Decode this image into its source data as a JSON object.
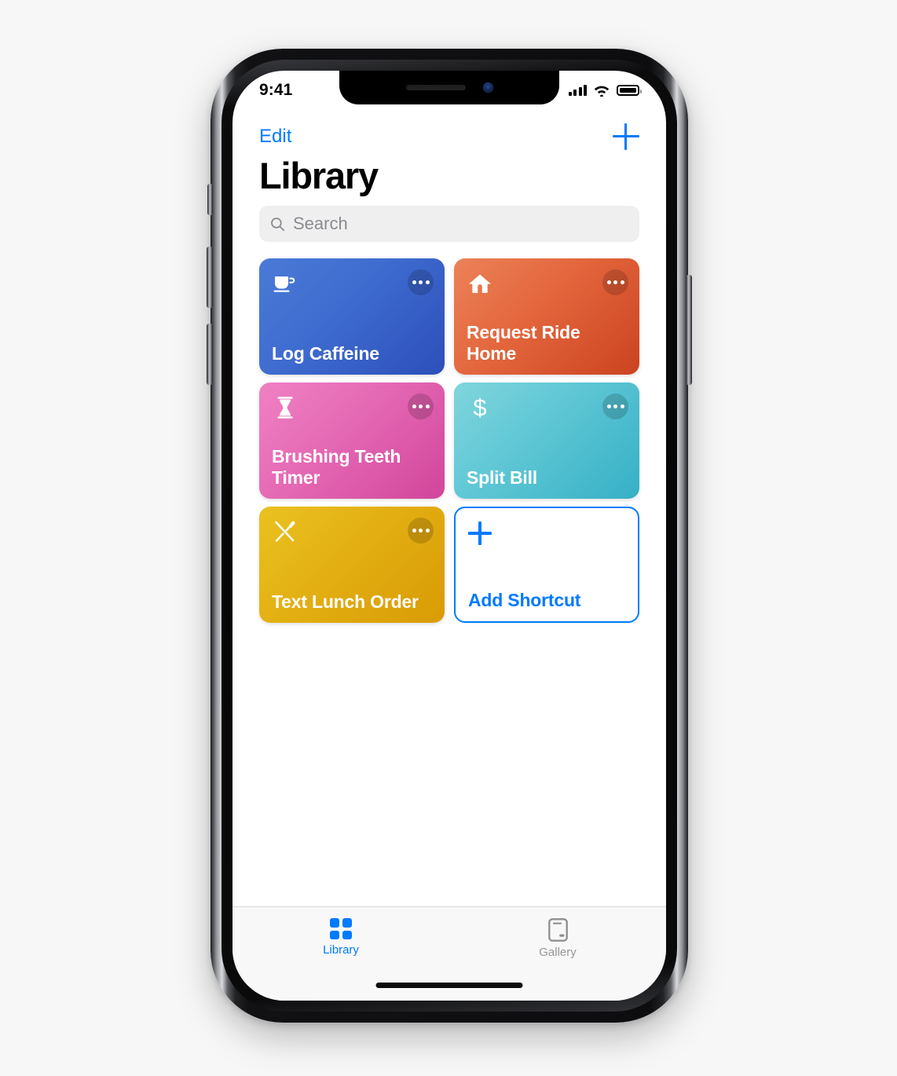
{
  "status_bar": {
    "time": "9:41",
    "signal_icon": "cellular-signal-icon",
    "wifi_icon": "wifi-icon",
    "battery_icon": "battery-full-icon"
  },
  "nav": {
    "edit_label": "Edit",
    "add_icon": "plus-icon"
  },
  "header": {
    "title": "Library"
  },
  "search": {
    "placeholder": "Search",
    "value": "",
    "icon": "search-icon"
  },
  "shortcuts": [
    {
      "label": "Log Caffeine",
      "icon": "coffee-cup-icon",
      "theme": "card-blue",
      "color": "#3f6dd0",
      "more_icon": "ellipsis-icon"
    },
    {
      "label": "Request Ride Home",
      "icon": "house-icon",
      "theme": "card-orange",
      "color": "#e3653c",
      "more_icon": "ellipsis-icon"
    },
    {
      "label": "Brushing Teeth Timer",
      "icon": "hourglass-icon",
      "theme": "card-pink",
      "color": "#e468b3",
      "more_icon": "ellipsis-icon"
    },
    {
      "label": "Split Bill",
      "icon": "dollar-sign-icon",
      "theme": "card-teal",
      "color": "#5dc6d4",
      "more_icon": "ellipsis-icon"
    },
    {
      "label": "Text Lunch Order",
      "icon": "fork-knife-icon",
      "theme": "card-yellow",
      "color": "#e2ae12",
      "more_icon": "ellipsis-icon"
    }
  ],
  "add_shortcut": {
    "label": "Add Shortcut",
    "icon": "plus-icon",
    "color": "#007aff"
  },
  "tab_bar": {
    "items": [
      {
        "label": "Library",
        "icon": "grid-squares-icon",
        "state": "active"
      },
      {
        "label": "Gallery",
        "icon": "phone-card-icon",
        "state": "inactive"
      }
    ]
  },
  "theme": {
    "accent": "#007aff",
    "page_background": "#f7f7f7",
    "screen_background": "#ffffff",
    "tab_bar_background": "#f8f8f8",
    "search_field_background": "#efeff0",
    "inactive_tab_color": "#96969b"
  }
}
